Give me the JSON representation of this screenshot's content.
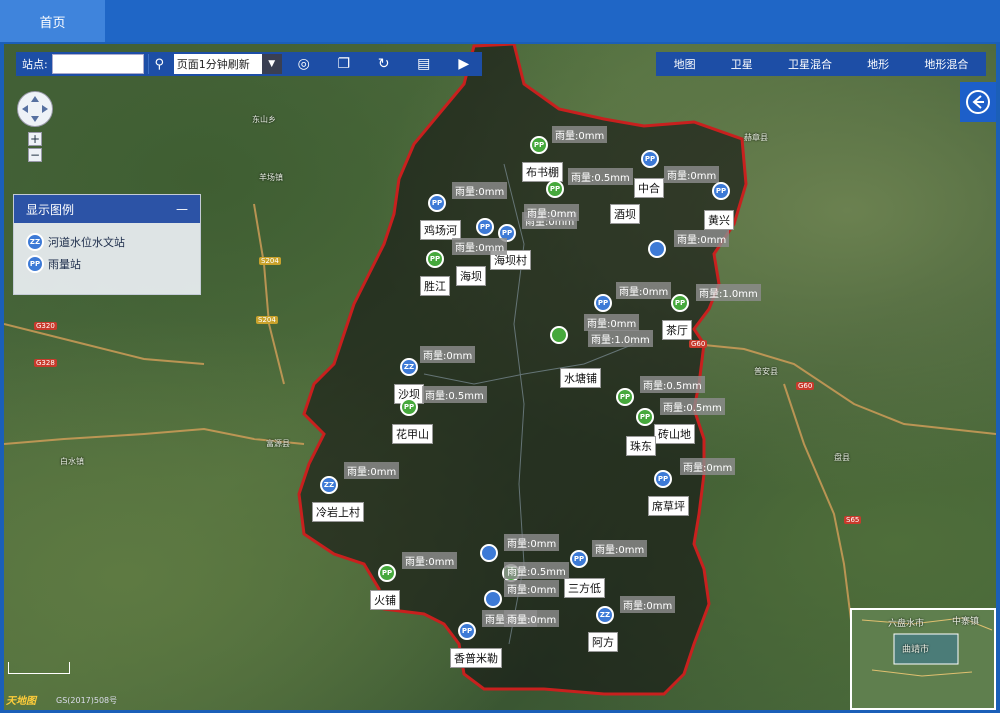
{
  "topbar": {
    "home_tab": "首页"
  },
  "toolbar": {
    "station_label": "站点:",
    "station_value": "",
    "refresh_select": "页面1分钟刷新"
  },
  "layers": [
    "地图",
    "卫星",
    "卫星混合",
    "地形",
    "地形混合"
  ],
  "legend": {
    "title": "显示图例",
    "collapse": "—",
    "items": [
      {
        "code": "ZZ",
        "label": "河道水位水文站"
      },
      {
        "code": "PP",
        "label": "雨量站"
      }
    ]
  },
  "stations": [
    {
      "name": "布书棚",
      "code": "PP",
      "rain": "雨量:0mm"
    },
    {
      "name": "中合",
      "code": "PP",
      "rain": "雨量:0mm"
    },
    {
      "name": "酒坝",
      "code": "PP",
      "rain": "雨量:0.5mm"
    },
    {
      "name": "黄兴",
      "code": "PP",
      "rain": "雨量:0mm"
    },
    {
      "name": "鸡场河",
      "code": "PP",
      "rain": "雨量:0mm"
    },
    {
      "name": "海坝村",
      "code": "PP",
      "rain": "雨量:0mm"
    },
    {
      "name": "海坝",
      "code": "PP",
      "rain": "雨量:0mm"
    },
    {
      "name": "胜江",
      "code": "PP",
      "rain": "雨量:0mm"
    },
    {
      "name": "茶厅",
      "code": "PP",
      "rain": "雨量:1.0mm"
    },
    {
      "name": "水塘铺",
      "code": "PP",
      "rain": "雨量:1.0mm"
    },
    {
      "name": "沙坝",
      "code": "ZZ",
      "rain": "雨量:0mm"
    },
    {
      "name": "花甲山",
      "code": "PP",
      "rain": "雨量:0.5mm"
    },
    {
      "name": "砖山地",
      "code": "PP",
      "rain": "雨量:0.5mm"
    },
    {
      "name": "珠东",
      "code": "PP",
      "rain": "雨量:0.5mm"
    },
    {
      "name": "席草坪",
      "code": "PP",
      "rain": "雨量:0mm"
    },
    {
      "name": "冷岩上村",
      "code": "ZZ",
      "rain": "雨量:0mm"
    },
    {
      "name": "火铺",
      "code": "PP",
      "rain": "雨量:0mm"
    },
    {
      "name": "三方低",
      "code": "PP",
      "rain": "雨量:0mm"
    },
    {
      "name": "阿方",
      "code": "ZZ",
      "rain": "雨量:0mm"
    },
    {
      "name": "香普米勒",
      "code": "PP",
      "rain": "雨量:0mm"
    }
  ],
  "extra_rain_labels": [
    "雨量:0mm",
    "雨量:0.5mm",
    "雨量:0mm",
    "雨量:0mm",
    "雨量:0mm",
    "雨量:0mm",
    "雨量:0mm",
    "雨量:0mm"
  ],
  "places": [
    "东山乡",
    "羊场镇",
    "赫章县",
    "普安县",
    "盘县",
    "富源县",
    "白水镇",
    "六盘水市",
    "曲靖市",
    "中寨镇"
  ],
  "roads": [
    "S204",
    "S204",
    "G320",
    "G328",
    "G60",
    "G60",
    "S65"
  ],
  "minimap": {
    "city1": "六盘水市",
    "city2": "曲靖市",
    "city3": "中寨镇"
  },
  "footer": {
    "logo": "天地图",
    "credit": "GS(2017)508号"
  }
}
